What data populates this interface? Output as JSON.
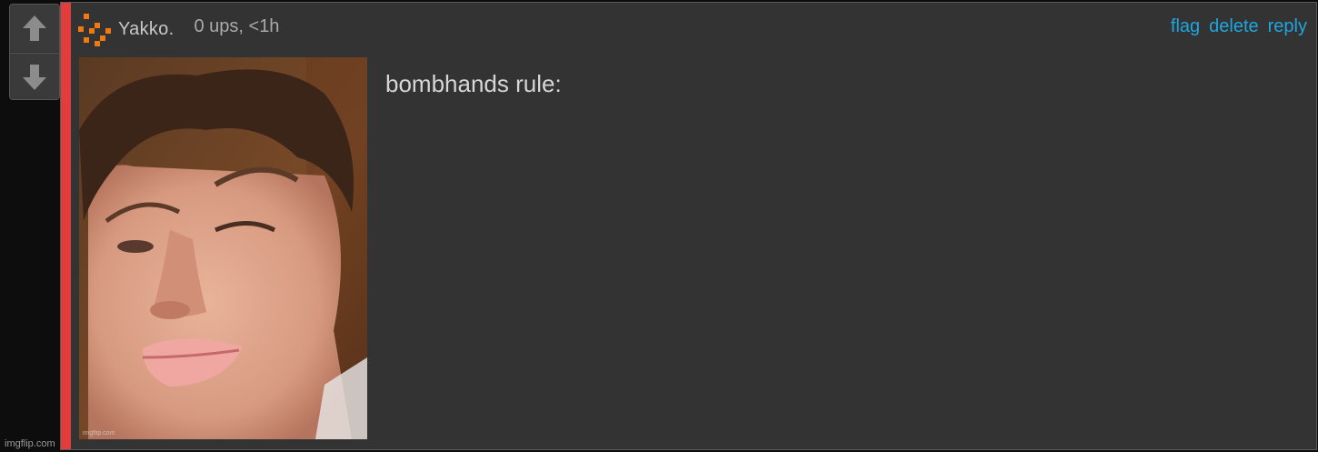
{
  "vote": {
    "upvote_icon": "arrow-up-icon",
    "downvote_icon": "arrow-down-icon"
  },
  "site_watermark": "imgflip.com",
  "comment": {
    "accent_color": "#e23c3c",
    "author": {
      "username": "Yakko.",
      "avatar_icon": "pixel-avatar-icon",
      "avatar_color": "#f07a12"
    },
    "meta": "0 ups, <1h",
    "actions": {
      "flag": "flag",
      "delete": "delete",
      "reply": "reply"
    },
    "link_color": "#1ea6e0",
    "text": "bombhands rule:",
    "image": {
      "watermark": "imgflip.com"
    }
  }
}
